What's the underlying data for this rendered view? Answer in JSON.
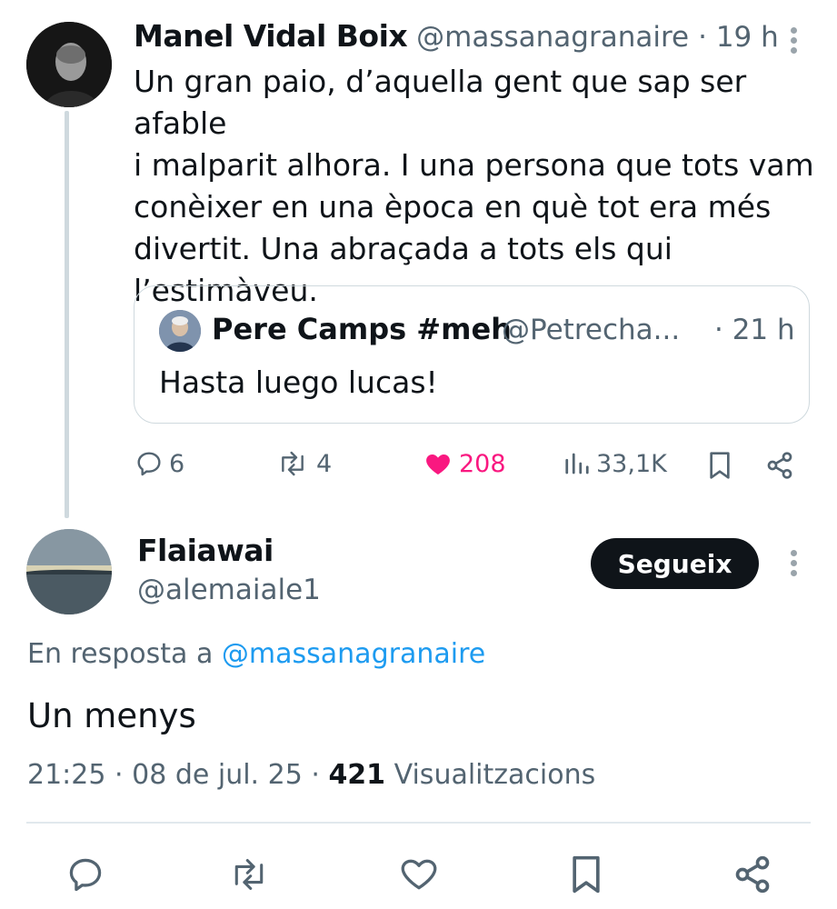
{
  "original_tweet": {
    "author_name": "Manel Vidal Boix",
    "author_handle": "@massanagranaire",
    "time": "· 19 h",
    "text_lines": [
      "Un gran paio, d’aquella gent que sap ser afable",
      "i malparit alhora. I una persona que tots vam",
      "conèixer en una època en què tot era més",
      "divertit. Una abraçada a tots els qui",
      "l’estimàveu."
    ],
    "quote": {
      "author_name": "Pere Camps #meh",
      "author_handle": "@Petrecha...",
      "time": "· 21 h",
      "text": "Hasta luego lucas!"
    },
    "actions": {
      "replies": "6",
      "reposts": "4",
      "likes": "208",
      "views": "33,1K"
    }
  },
  "reply": {
    "author_name": "Flaiawai",
    "author_handle": "@alemaiale1",
    "follow_label": "Segueix",
    "in_reply_prefix": "En resposta a",
    "in_reply_handle": "@massanagranaire",
    "text": "Un menys",
    "time": "21:25",
    "date": "08 de jul. 25",
    "separator": "·",
    "views_count": "421",
    "views_label": "Visualitzacions"
  },
  "colors": {
    "text": "#0f1419",
    "muted": "#536471",
    "like": "#f91880",
    "link": "#1d9bf0",
    "button": "#0f1419"
  }
}
